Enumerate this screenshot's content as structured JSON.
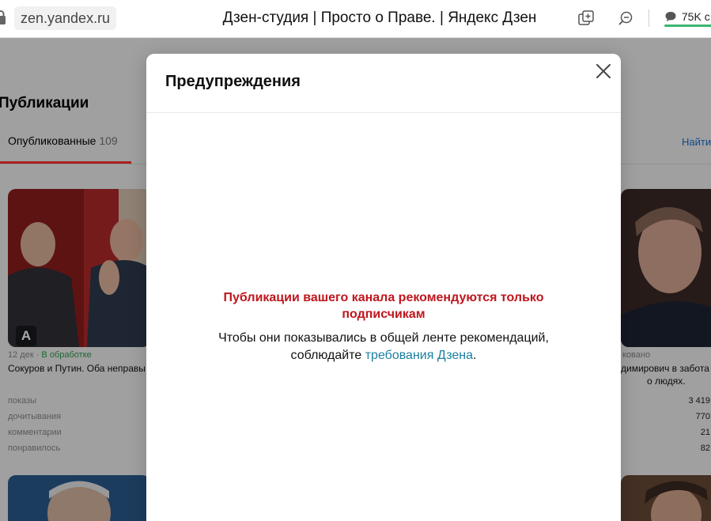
{
  "browser": {
    "url": "zen.yandex.ru",
    "tab_title": "Дзен-студия | Просто о Праве. | Яндекс Дзен",
    "icons": [
      "lock-icon",
      "add-tab-icon",
      "zoom-out-icon",
      "comment-icon"
    ],
    "comments_count": "75K с"
  },
  "page": {
    "title": "Публикации",
    "tabs": {
      "published_label": "Опубликованные",
      "published_count": "109",
      "find_link": "Найти"
    },
    "cards": [
      {
        "badge": "A",
        "date": "12 дек",
        "separator": " · ",
        "status": "В обработке",
        "caption": "Сокуров и Путин. Оба неправы.",
        "stats": [
          {
            "label": "показы"
          },
          {
            "label": "дочитывания"
          },
          {
            "label": "комментарии"
          },
          {
            "label": "понравилось"
          }
        ]
      },
      {
        "status_fragment": "ковано",
        "caption_line1": "димирович в забота",
        "caption_line2": "о людях.",
        "stats_values": [
          "3 419",
          "770",
          "21",
          "82"
        ]
      }
    ]
  },
  "modal": {
    "title": "Предупреждения",
    "warning_title": "Публикации вашего канала рекомендуются только подписчикам",
    "body_line1": "Чтобы они показывались в общей ленте рекомендаций,",
    "body_line2_prefix": "соблюдайте ",
    "body_link": "требования Дзена",
    "body_line2_suffix": "."
  },
  "colors": {
    "warning_red": "#c0161d",
    "link_teal": "#1a7fa0",
    "tab_accent": "#ff3333",
    "status_green": "#2ca24c"
  }
}
